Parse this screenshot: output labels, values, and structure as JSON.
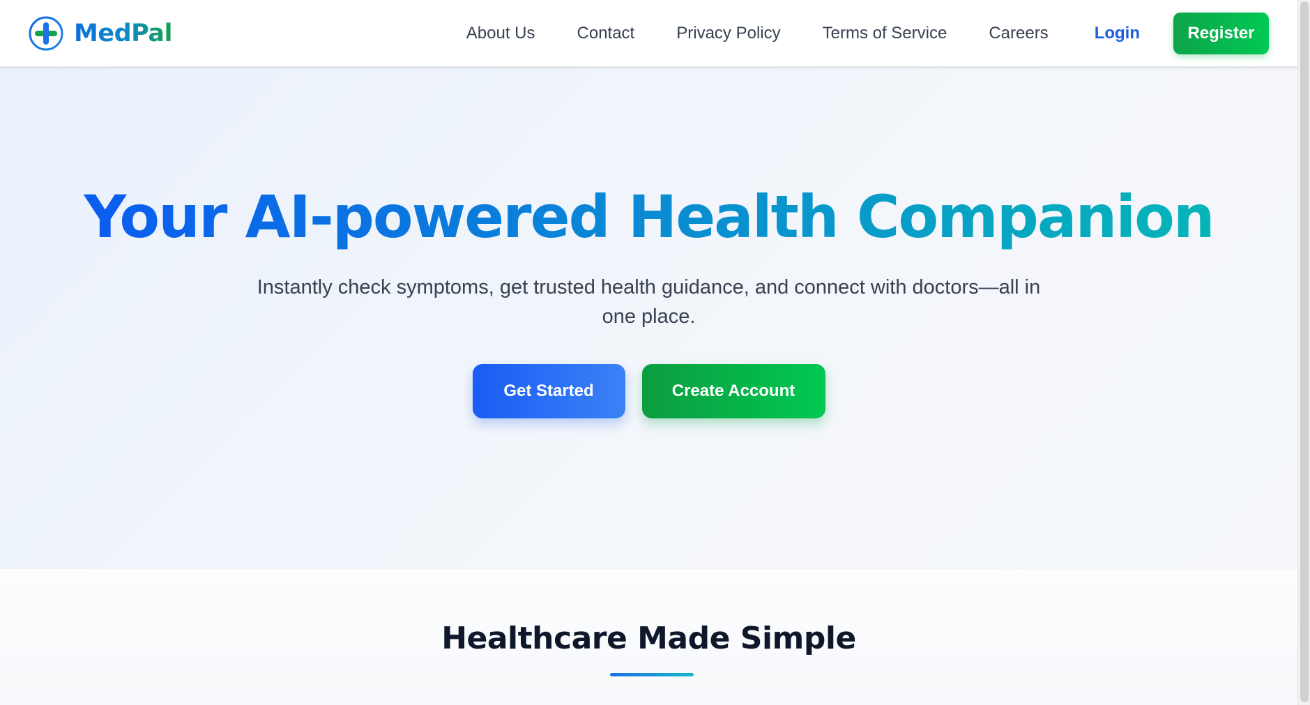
{
  "brand": {
    "name": "MedPal",
    "icon": "medical-cross-icon",
    "colors": {
      "blue": "#0b6fe0",
      "green": "#16a34a"
    }
  },
  "nav": {
    "links": [
      "About Us",
      "Contact",
      "Privacy Policy",
      "Terms of Service",
      "Careers"
    ],
    "login_label": "Login",
    "register_label": "Register"
  },
  "hero": {
    "title": "Your AI-powered Health Companion",
    "subtitle": "Instantly check symptoms, get trusted health guidance, and connect with doctors—all in one place.",
    "primary_cta": "Get Started",
    "secondary_cta": "Create Account"
  },
  "features": {
    "title": "Healthcare Made Simple"
  },
  "colors": {
    "primary": "#1a5cf5",
    "success": "#00c853",
    "title_gradient_start": "#0b5cf0",
    "title_gradient_end": "#05b5b8"
  }
}
